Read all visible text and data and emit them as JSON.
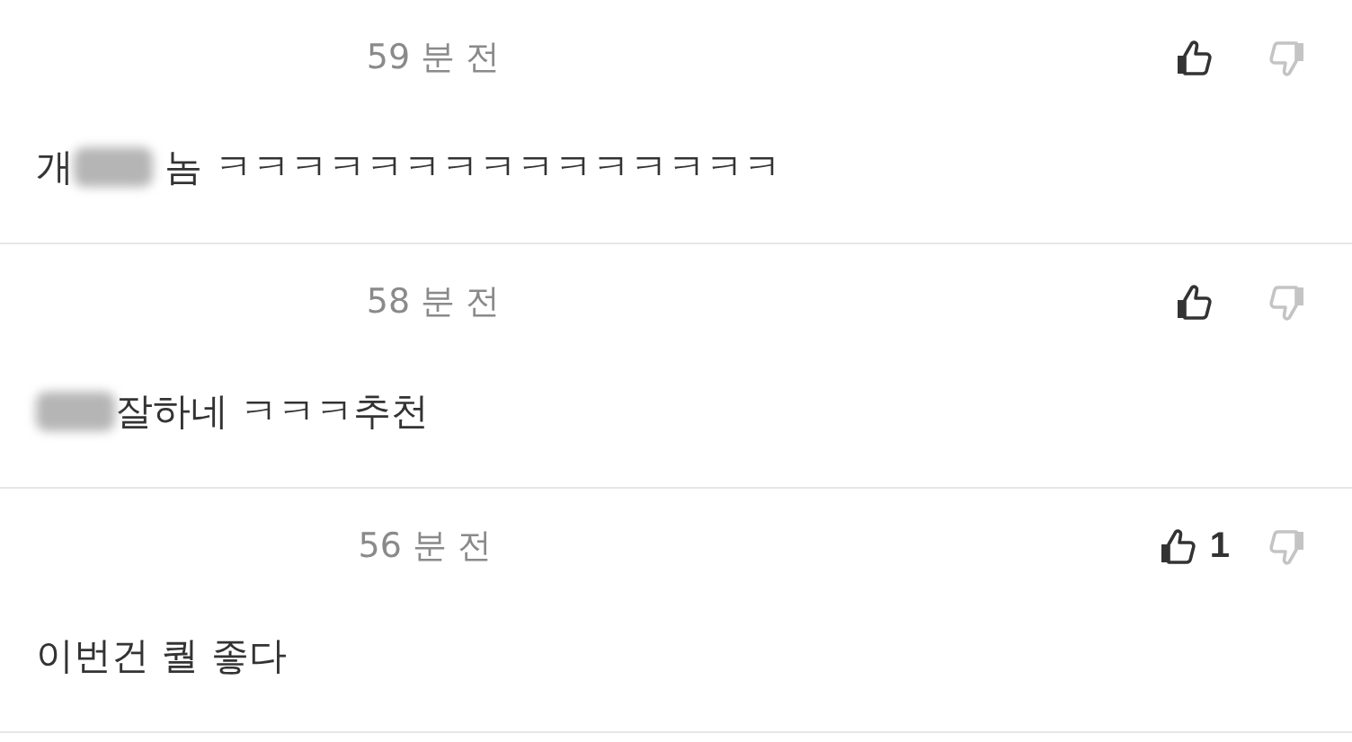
{
  "comments": [
    {
      "time": "59 분 전",
      "text_parts": [
        {
          "kind": "text",
          "text": "개"
        },
        {
          "kind": "blur"
        },
        {
          "kind": "text",
          "text": " 놈 ㅋㅋㅋㅋㅋㅋㅋㅋㅋㅋㅋㅋㅋㅋㅋ"
        }
      ]
    },
    {
      "time": "58 분 전",
      "text_parts": [
        {
          "kind": "blur"
        },
        {
          "kind": "text",
          "text": "잘하네 ㅋㅋㅋ추천"
        }
      ]
    },
    {
      "time": "56 분 전",
      "like_count": "1",
      "text_parts": [
        {
          "kind": "text",
          "text": "이번건 퀄 좋다"
        }
      ]
    }
  ]
}
